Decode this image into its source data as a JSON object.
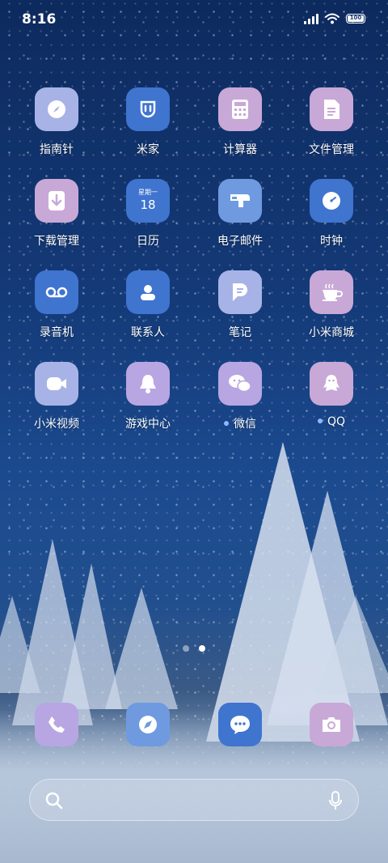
{
  "status_bar": {
    "time": "8:16",
    "battery_label": "100"
  },
  "apps": [
    {
      "label": "指南针",
      "icon": "compass-icon",
      "color": "#a7b3e6",
      "has_dot": false
    },
    {
      "label": "米家",
      "icon": "mijia-icon",
      "color": "#3f74cf",
      "has_dot": false
    },
    {
      "label": "计算器",
      "icon": "calculator-icon",
      "color": "#c8a8d6",
      "has_dot": false
    },
    {
      "label": "文件管理",
      "icon": "file-manager-icon",
      "color": "#c8a8d6",
      "has_dot": false
    },
    {
      "label": "下载管理",
      "icon": "download-icon",
      "color": "#c8a8d6",
      "has_dot": false
    },
    {
      "label": "日历",
      "icon": "calendar-icon",
      "color": "#3f74cf",
      "has_dot": false,
      "calendar": {
        "weekday": "星期一",
        "day": "18"
      }
    },
    {
      "label": "电子邮件",
      "icon": "email-icon",
      "color": "#6f9ae0",
      "has_dot": false
    },
    {
      "label": "时钟",
      "icon": "clock-icon",
      "color": "#3f74cf",
      "has_dot": false
    },
    {
      "label": "录音机",
      "icon": "recorder-icon",
      "color": "#3f74cf",
      "has_dot": false
    },
    {
      "label": "联系人",
      "icon": "contacts-icon",
      "color": "#3f74cf",
      "has_dot": false
    },
    {
      "label": "笔记",
      "icon": "notes-icon",
      "color": "#a7b3e6",
      "has_dot": false
    },
    {
      "label": "小米商城",
      "icon": "mi-store-icon",
      "color": "#c8a8d6",
      "has_dot": false
    },
    {
      "label": "小米视频",
      "icon": "video-icon",
      "color": "#a7b3e6",
      "has_dot": false
    },
    {
      "label": "游戏中心",
      "icon": "game-center-icon",
      "color": "#b7a6e2",
      "has_dot": false
    },
    {
      "label": "微信",
      "icon": "wechat-icon",
      "color": "#b7a6e2",
      "has_dot": true
    },
    {
      "label": "QQ",
      "icon": "qq-icon",
      "color": "#c8a8d6",
      "has_dot": true
    }
  ],
  "dock": [
    {
      "icon": "phone-icon",
      "color": "#b7a6e2"
    },
    {
      "icon": "browser-icon",
      "color": "#6f9ae0"
    },
    {
      "icon": "messages-icon",
      "color": "#3f74cf"
    },
    {
      "icon": "camera-icon",
      "color": "#c8a8d6"
    }
  ],
  "page_indicator": {
    "pages": 2,
    "active": 2
  },
  "search_bar": {
    "left_icon": "search-icon",
    "right_icon": "microphone-icon"
  }
}
